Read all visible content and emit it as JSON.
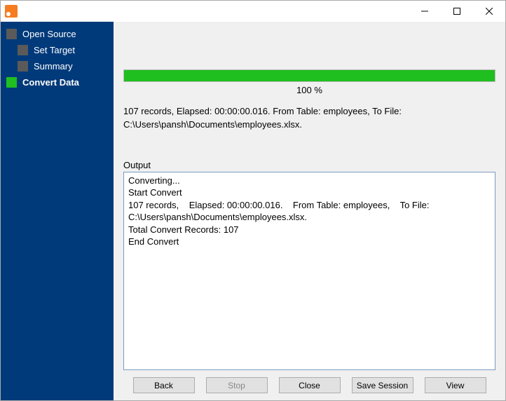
{
  "window": {
    "title": ""
  },
  "sidebar": {
    "items": [
      {
        "label": "Open Source",
        "active": false,
        "child": false
      },
      {
        "label": "Set Target",
        "active": false,
        "child": true
      },
      {
        "label": "Summary",
        "active": false,
        "child": true
      },
      {
        "label": "Convert Data",
        "active": true,
        "child": false
      }
    ]
  },
  "progress": {
    "percent_label": "100 %",
    "fill_percent": 100
  },
  "status_line": "107 records,    Elapsed: 00:00:00.016.    From Table: employees,    To File: C:\\Users\\pansh\\Documents\\employees.xlsx.",
  "output": {
    "label": "Output",
    "text": "Converting...\nStart Convert\n107 records,    Elapsed: 00:00:00.016.    From Table: employees,    To File: C:\\Users\\pansh\\Documents\\employees.xlsx.\nTotal Convert Records: 107\nEnd Convert\n"
  },
  "buttons": {
    "back": "Back",
    "stop": "Stop",
    "close": "Close",
    "save_session": "Save Session",
    "view": "View"
  }
}
